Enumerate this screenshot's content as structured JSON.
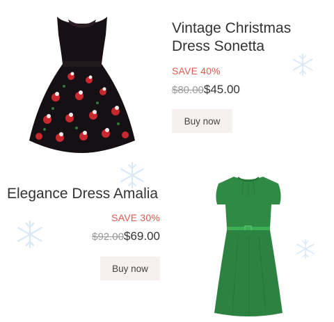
{
  "products": [
    {
      "name": "Vintage Christmas Dress Sonetta",
      "name_line1": "Vintage Christmas",
      "name_line2": "Dress Sonetta",
      "sale": "SAVE 40%",
      "old_price": "$80.00",
      "new_price": "$45.00",
      "button": "Buy now",
      "image": "black-christmas-print-dress"
    },
    {
      "name": "Elegance Dress Amalia",
      "sale": "SAVE 30%",
      "old_price": "$92.00",
      "new_price": "$69.00",
      "button": "Buy now",
      "image": "green-belted-dress"
    }
  ],
  "colors": {
    "sale_red": "#e05a4f",
    "button_bg": "#f6f1ef",
    "snowflake": "#dbe9f7",
    "dress_black": "#171014",
    "dress_green": "#2f8a44"
  },
  "decor": "snowflake-icon"
}
